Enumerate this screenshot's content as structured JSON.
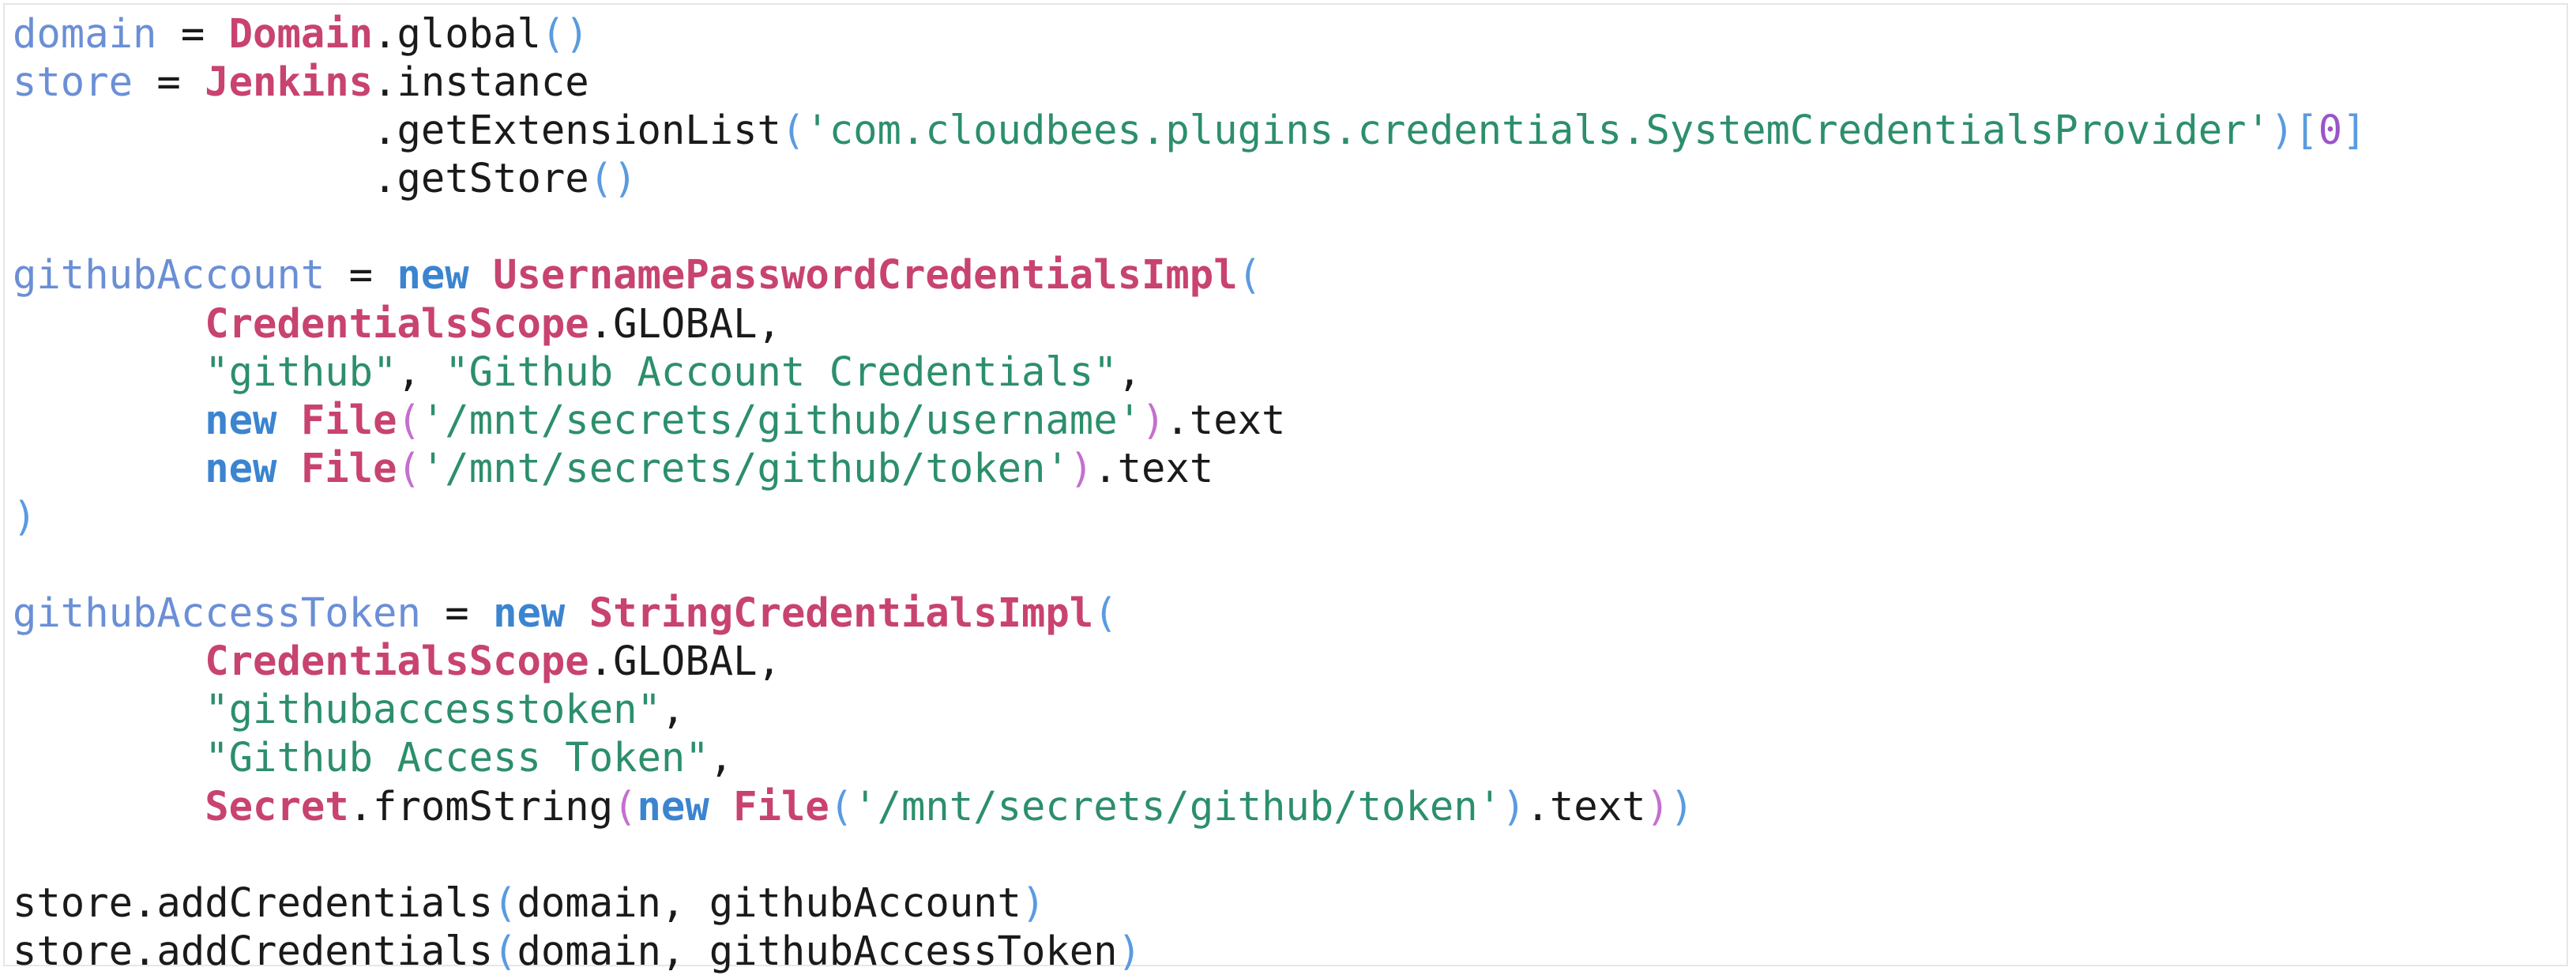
{
  "colors": {
    "background": "#ffffff",
    "border": "#e6e6e6",
    "variable": "#6b8fd6",
    "class_name": "#c8436f",
    "keyword": "#3b84d0",
    "string": "#2c8f6b",
    "number": "#9a55c9",
    "plain": "#1a1a1a",
    "paren_level_1": "#5a9be0",
    "paren_level_2": "#c46fcf"
  },
  "code_lines": [
    [
      {
        "t": "domain",
        "c": "var"
      },
      {
        "t": " = ",
        "c": "plain"
      },
      {
        "t": "Domain",
        "c": "class"
      },
      {
        "t": ".global",
        "c": "plain"
      },
      {
        "t": "()",
        "c": "p1"
      }
    ],
    [
      {
        "t": "store",
        "c": "var"
      },
      {
        "t": " = ",
        "c": "plain"
      },
      {
        "t": "Jenkins",
        "c": "class"
      },
      {
        "t": ".instance",
        "c": "plain"
      }
    ],
    [
      {
        "t": "               .getExtensionList",
        "c": "plain"
      },
      {
        "t": "(",
        "c": "p1"
      },
      {
        "t": "'com.cloudbees.plugins.credentials.SystemCredentialsProvider'",
        "c": "str"
      },
      {
        "t": ")[",
        "c": "p1"
      },
      {
        "t": "0",
        "c": "num"
      },
      {
        "t": "]",
        "c": "p1"
      }
    ],
    [
      {
        "t": "               .getStore",
        "c": "plain"
      },
      {
        "t": "()",
        "c": "p1"
      }
    ],
    [],
    [
      {
        "t": "githubAccount",
        "c": "var"
      },
      {
        "t": " = ",
        "c": "plain"
      },
      {
        "t": "new",
        "c": "kw"
      },
      {
        "t": " ",
        "c": "plain"
      },
      {
        "t": "UsernamePasswordCredentialsImpl",
        "c": "class"
      },
      {
        "t": "(",
        "c": "p1"
      }
    ],
    [
      {
        "t": "        ",
        "c": "plain"
      },
      {
        "t": "CredentialsScope",
        "c": "class"
      },
      {
        "t": ".GLOBAL,",
        "c": "plain"
      }
    ],
    [
      {
        "t": "        ",
        "c": "plain"
      },
      {
        "t": "\"github\"",
        "c": "str"
      },
      {
        "t": ", ",
        "c": "plain"
      },
      {
        "t": "\"Github Account Credentials\"",
        "c": "str"
      },
      {
        "t": ",",
        "c": "plain"
      }
    ],
    [
      {
        "t": "        ",
        "c": "plain"
      },
      {
        "t": "new",
        "c": "kw"
      },
      {
        "t": " ",
        "c": "plain"
      },
      {
        "t": "File",
        "c": "class"
      },
      {
        "t": "(",
        "c": "p2"
      },
      {
        "t": "'/mnt/secrets/github/username'",
        "c": "str"
      },
      {
        "t": ")",
        "c": "p2"
      },
      {
        "t": ".text",
        "c": "plain"
      }
    ],
    [
      {
        "t": "        ",
        "c": "plain"
      },
      {
        "t": "new",
        "c": "kw"
      },
      {
        "t": " ",
        "c": "plain"
      },
      {
        "t": "File",
        "c": "class"
      },
      {
        "t": "(",
        "c": "p2"
      },
      {
        "t": "'/mnt/secrets/github/token'",
        "c": "str"
      },
      {
        "t": ")",
        "c": "p2"
      },
      {
        "t": ".text",
        "c": "plain"
      }
    ],
    [
      {
        "t": ")",
        "c": "p1"
      }
    ],
    [],
    [
      {
        "t": "githubAccessToken",
        "c": "var"
      },
      {
        "t": " = ",
        "c": "plain"
      },
      {
        "t": "new",
        "c": "kw"
      },
      {
        "t": " ",
        "c": "plain"
      },
      {
        "t": "StringCredentialsImpl",
        "c": "class"
      },
      {
        "t": "(",
        "c": "p1"
      }
    ],
    [
      {
        "t": "        ",
        "c": "plain"
      },
      {
        "t": "CredentialsScope",
        "c": "class"
      },
      {
        "t": ".GLOBAL,",
        "c": "plain"
      }
    ],
    [
      {
        "t": "        ",
        "c": "plain"
      },
      {
        "t": "\"githubaccesstoken\"",
        "c": "str"
      },
      {
        "t": ",",
        "c": "plain"
      }
    ],
    [
      {
        "t": "        ",
        "c": "plain"
      },
      {
        "t": "\"Github Access Token\"",
        "c": "str"
      },
      {
        "t": ",",
        "c": "plain"
      }
    ],
    [
      {
        "t": "        ",
        "c": "plain"
      },
      {
        "t": "Secret",
        "c": "class"
      },
      {
        "t": ".fromString",
        "c": "plain"
      },
      {
        "t": "(",
        "c": "p2"
      },
      {
        "t": "new",
        "c": "kw"
      },
      {
        "t": " ",
        "c": "plain"
      },
      {
        "t": "File",
        "c": "class"
      },
      {
        "t": "(",
        "c": "p1"
      },
      {
        "t": "'/mnt/secrets/github/token'",
        "c": "str"
      },
      {
        "t": ")",
        "c": "p1"
      },
      {
        "t": ".text",
        "c": "plain"
      },
      {
        "t": ")",
        "c": "p2"
      },
      {
        "t": ")",
        "c": "p1"
      }
    ],
    [],
    [
      {
        "t": "store.addCredentials",
        "c": "plain"
      },
      {
        "t": "(",
        "c": "p1"
      },
      {
        "t": "domain, githubAccount",
        "c": "plain"
      },
      {
        "t": ")",
        "c": "p1"
      }
    ],
    [
      {
        "t": "store.addCredentials",
        "c": "plain"
      },
      {
        "t": "(",
        "c": "p1"
      },
      {
        "t": "domain, githubAccessToken",
        "c": "plain"
      },
      {
        "t": ")",
        "c": "p1"
      }
    ]
  ]
}
